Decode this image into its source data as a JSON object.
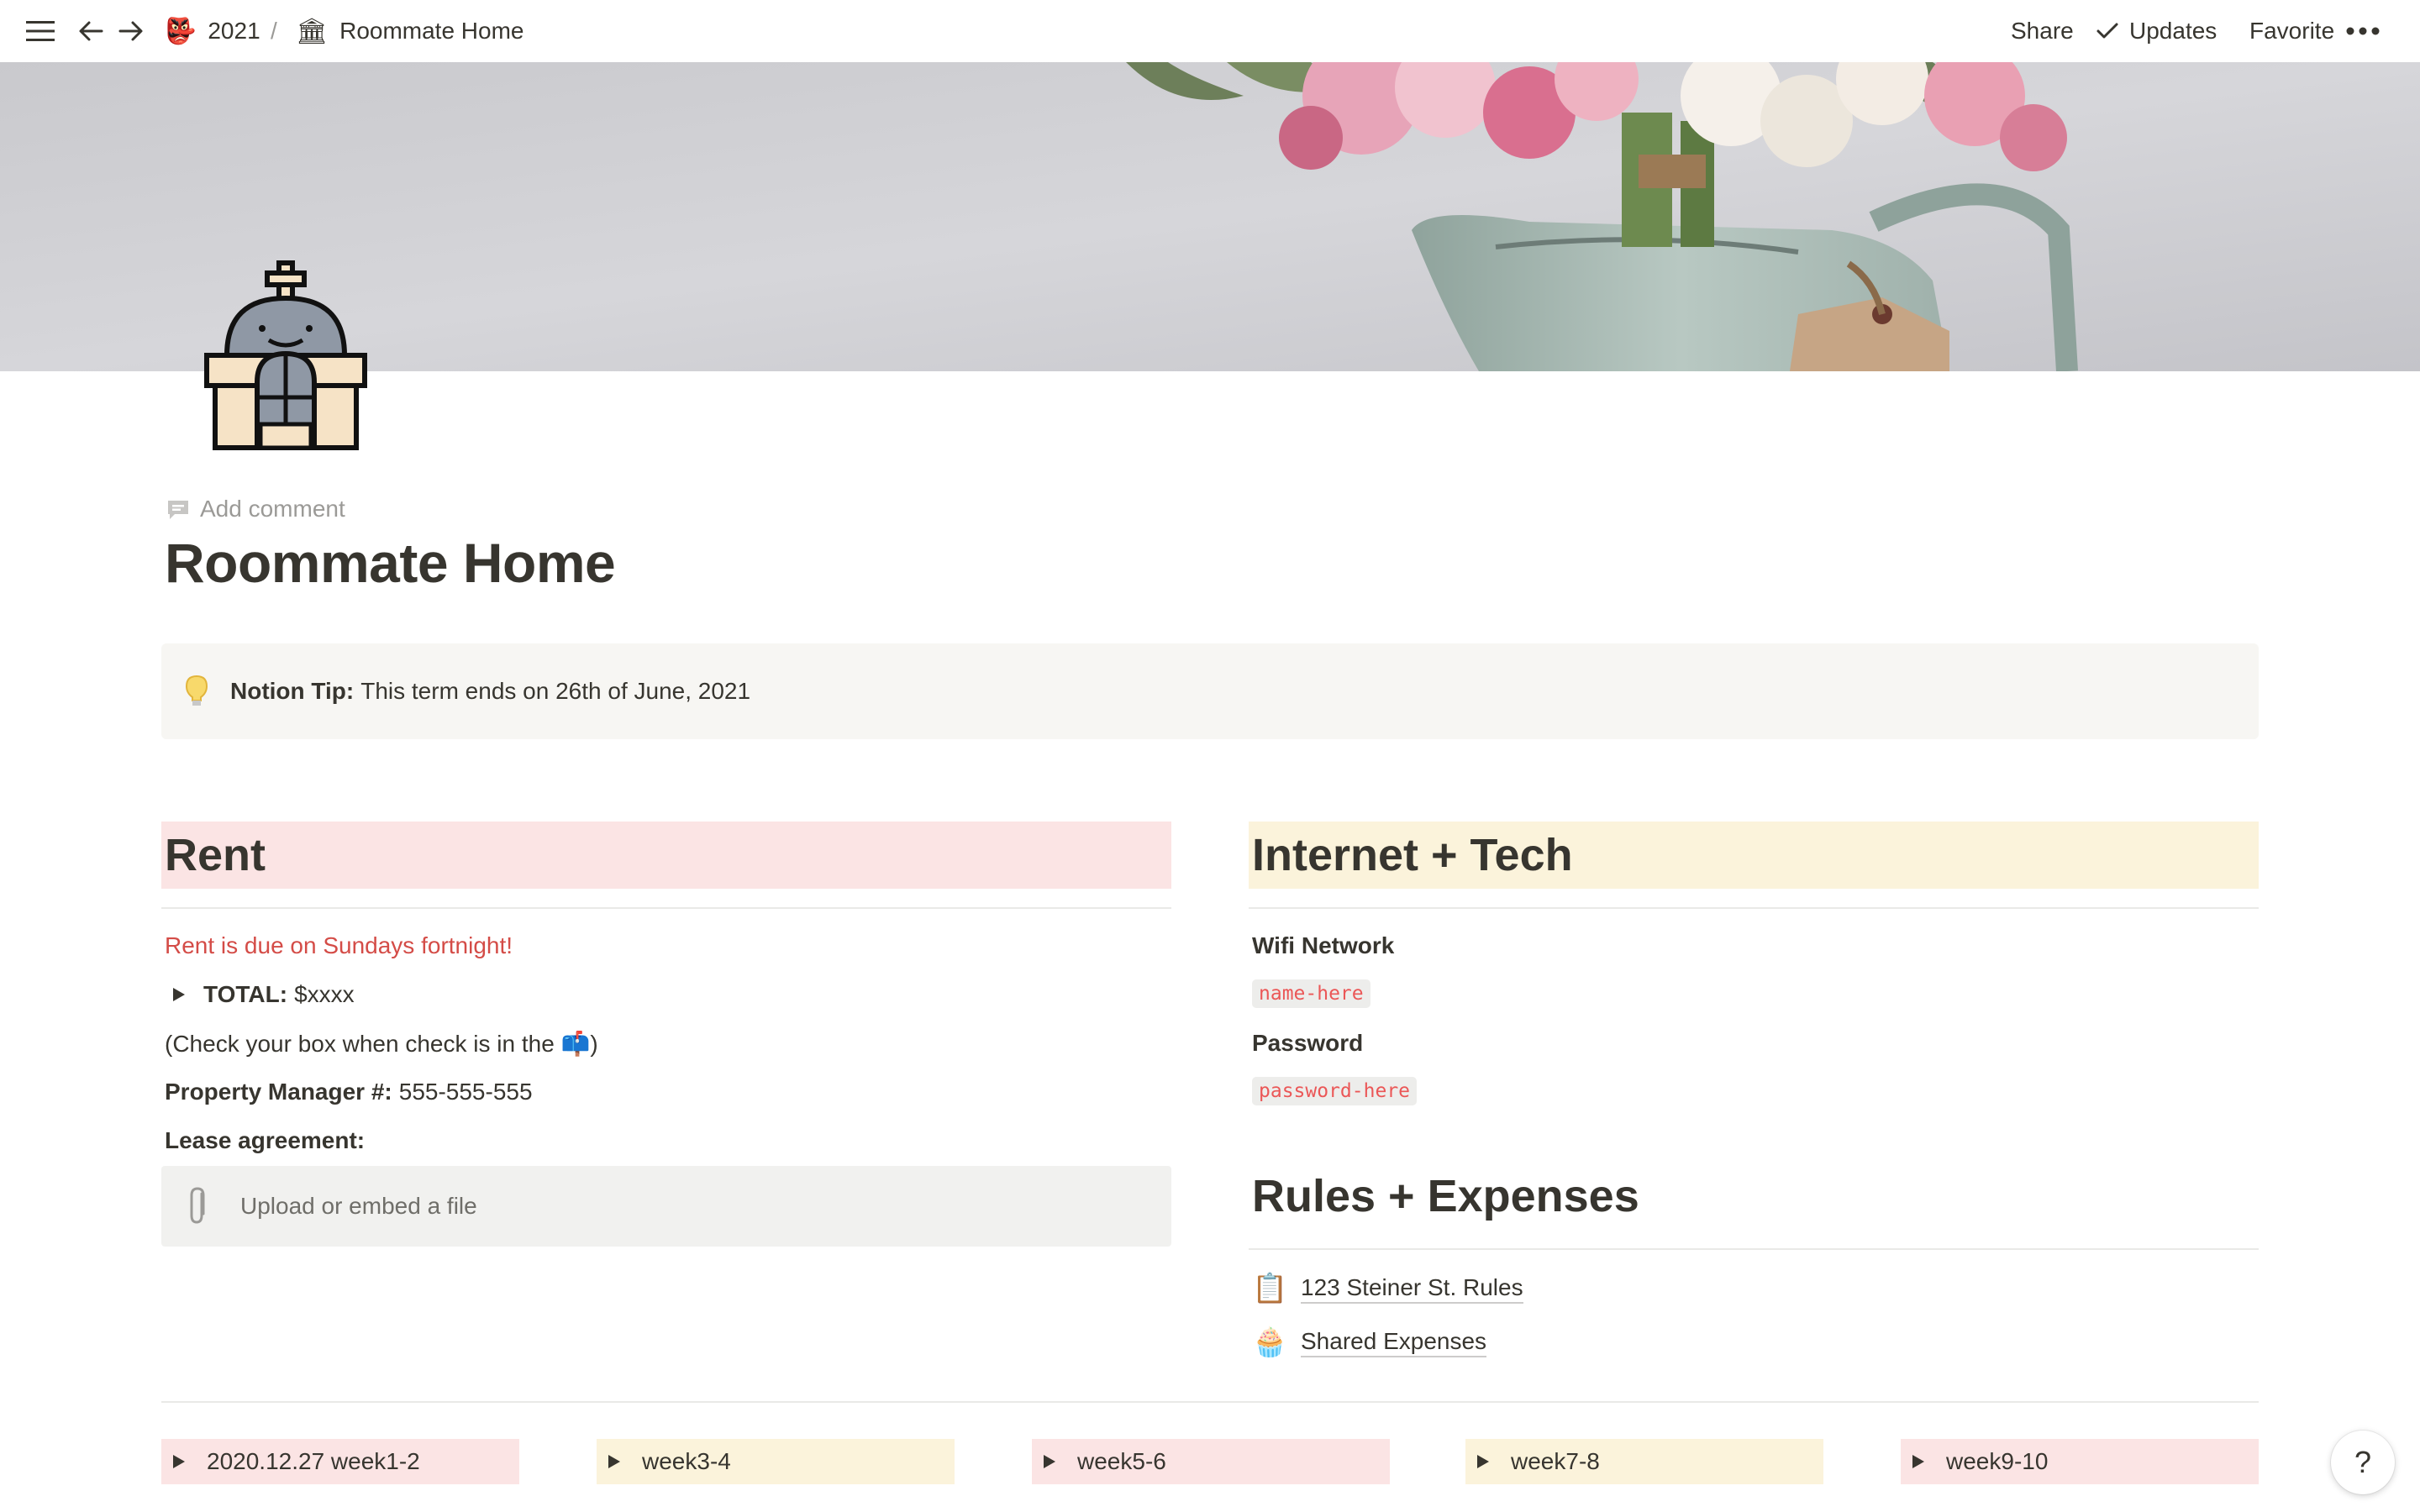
{
  "topbar": {
    "breadcrumb": [
      {
        "emoji": "👺",
        "label": "2021"
      },
      {
        "emoji": "🏛",
        "label": "Roommate Home"
      }
    ],
    "separator": "/",
    "share_label": "Share",
    "updates_label": "Updates",
    "favorite_label": "Favorite",
    "more_label": "•••"
  },
  "page": {
    "add_comment": "Add comment",
    "title": "Roommate Home",
    "callout": {
      "bold": "Notion Tip:",
      "text": "This term ends on 26th of June, 2021"
    }
  },
  "rent": {
    "heading": "Rent",
    "due_note": "Rent is due on Sundays fortnight!",
    "total_label": "TOTAL:",
    "total_value": "$xxxx",
    "check_note": "(Check your box when check is in the 📫)",
    "manager_label": "Property Manager #:",
    "manager_value": "555-555-555",
    "lease_label": "Lease agreement:",
    "upload_label": "Upload or embed a file"
  },
  "internet": {
    "heading": "Internet + Tech",
    "wifi_label": "Wifi Network",
    "wifi_value": "name-here",
    "password_label": "Password",
    "password_value": "password-here"
  },
  "rules": {
    "heading": "Rules + Expenses",
    "links": [
      {
        "emoji": "📋",
        "label": "123 Steiner St. Rules"
      },
      {
        "emoji": "🧁",
        "label": "Shared Expenses"
      }
    ]
  },
  "weeks": [
    {
      "label": "2020.12.27 week1-2",
      "color": "#fbe4e4"
    },
    {
      "label": "week3-4",
      "color": "#fbf3db"
    },
    {
      "label": "week5-6",
      "color": "#fbe4e4"
    },
    {
      "label": "week7-8",
      "color": "#fbf3db"
    },
    {
      "label": "week9-10",
      "color": "#fbe4e4"
    }
  ],
  "help_label": "?"
}
